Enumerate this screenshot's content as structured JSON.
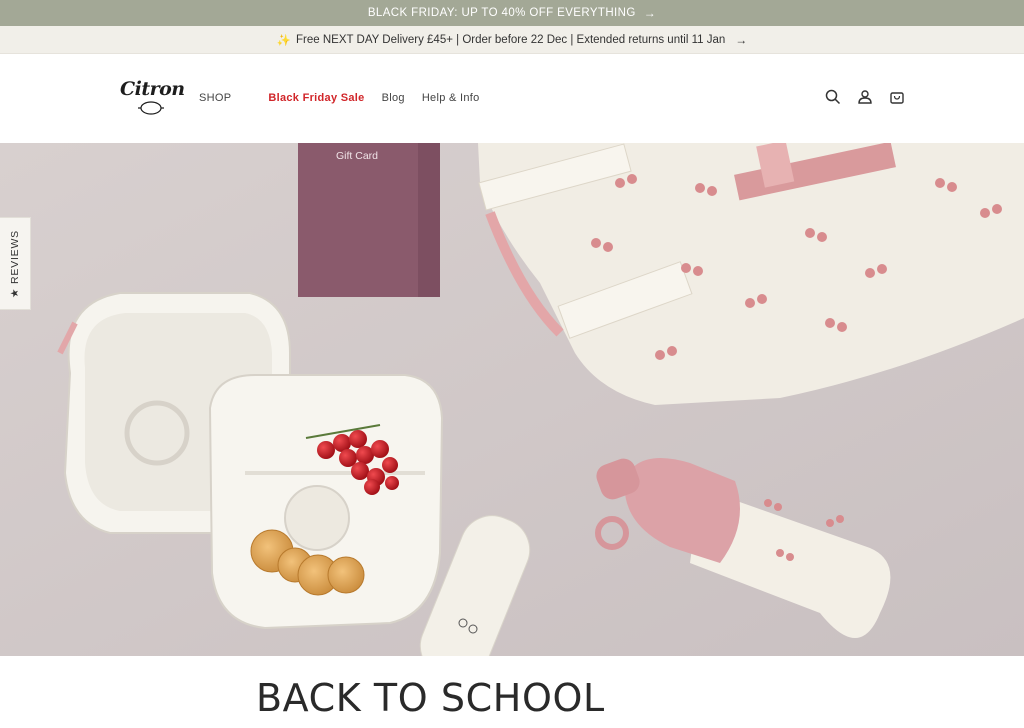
{
  "promo": {
    "text": "BLACK FRIDAY: UP TO 40% OFF EVERYTHING",
    "arrow": "→"
  },
  "delivery": {
    "spark": "✨",
    "text": "Free NEXT DAY Delivery £45+ | Order before 22 Dec | Extended returns until 11 Jan",
    "arrow": "→"
  },
  "header": {
    "logo_text": "Citron",
    "nav": [
      {
        "label": "SHOP"
      },
      {
        "label": "Black Friday Sale"
      },
      {
        "label": "Blog"
      },
      {
        "label": "Help & Info"
      }
    ],
    "icons": [
      "search-icon",
      "account-icon",
      "cart-icon"
    ]
  },
  "hero": {
    "gift_card_label": "Gift Card",
    "colors": {
      "background": "#cfc7c7",
      "pink": "#d9a4a6",
      "cream": "#f3efe6",
      "berry": "#c0141c"
    }
  },
  "reviews_tab": {
    "star": "★",
    "label": "REVIEWS"
  },
  "section": {
    "title": "BACK TO SCHOOL"
  }
}
